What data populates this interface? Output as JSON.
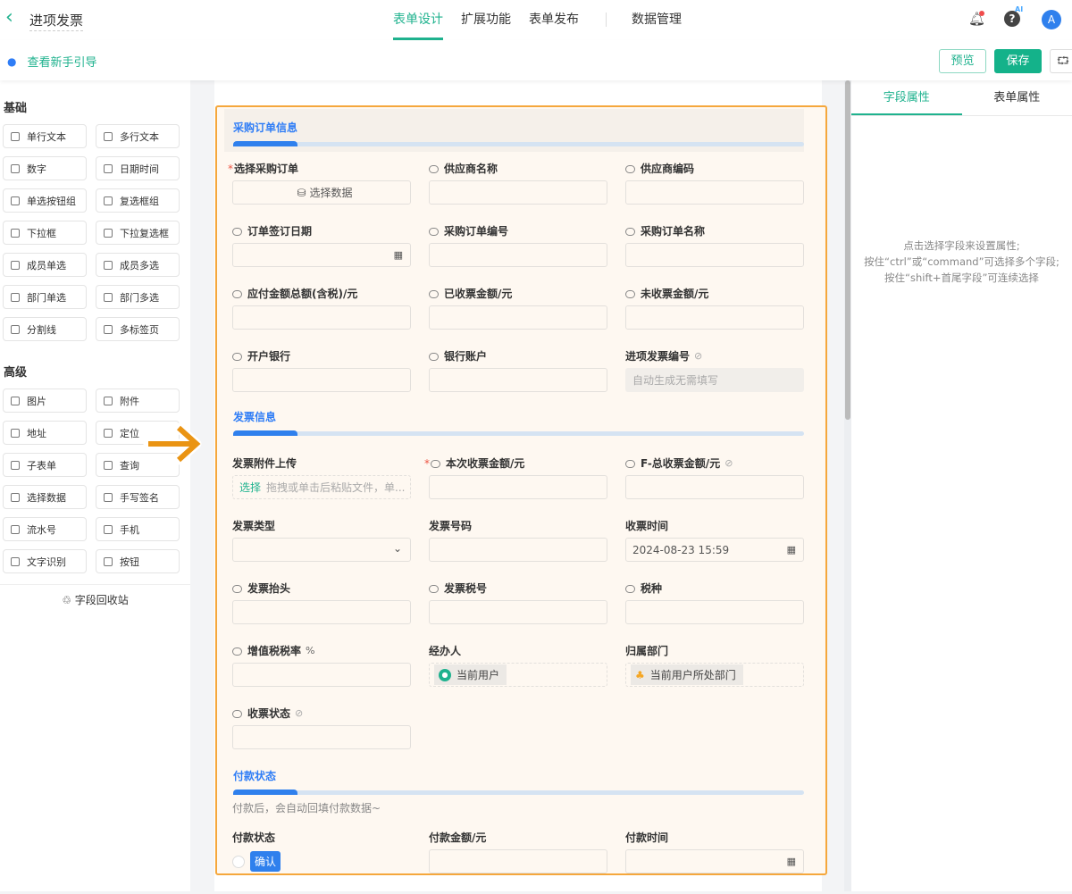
{
  "header": {
    "back_icon": "chevron-left-icon",
    "title": "进项发票",
    "tabs": [
      "表单设计",
      "扩展功能",
      "表单发布",
      "数据管理"
    ],
    "active_tab": 0,
    "ai_badge": "AI",
    "avatar": "A"
  },
  "toolbar": {
    "guide": "查看新手引导",
    "preview": "预览",
    "save": "保存"
  },
  "left": {
    "basic_title": "基础",
    "basic": [
      "单行文本",
      "多行文本",
      "数字",
      "日期时间",
      "单选按钮组",
      "复选框组",
      "下拉框",
      "下拉复选框",
      "成员单选",
      "成员多选",
      "部门单选",
      "部门多选",
      "分割线",
      "多标签页"
    ],
    "advanced_title": "高级",
    "advanced": [
      "图片",
      "附件",
      "地址",
      "定位",
      "子表单",
      "查询",
      "选择数据",
      "手写签名",
      "流水号",
      "手机",
      "文字识别",
      "按钮"
    ],
    "recycle": "字段回收站"
  },
  "sections": [
    {
      "title": "采购订单信息",
      "fields": [
        {
          "label": "选择采购订单",
          "required": true,
          "value": "选择数据"
        },
        {
          "label": "供应商名称",
          "link": true
        },
        {
          "label": "供应商编码",
          "link": true
        },
        {
          "label": "订单签订日期",
          "link": true,
          "calendar": true
        },
        {
          "label": "采购订单编号",
          "link": true
        },
        {
          "label": "采购订单名称",
          "link": true
        },
        {
          "label": "应付金额总额(含税)/元",
          "link": true
        },
        {
          "label": "已收票金额/元",
          "link": true
        },
        {
          "label": "未收票金额/元",
          "link": true
        },
        {
          "label": "开户银行",
          "link": true
        },
        {
          "label": "银行账户",
          "link": true
        },
        {
          "label": "进项发票编号",
          "hidden": true,
          "placeholder": "自动生成无需填写"
        }
      ]
    },
    {
      "title": "发票信息",
      "fields": [
        {
          "label": "发票附件上传",
          "upload_action": "选择",
          "placeholder": "拖拽或单击后粘贴文件，单..."
        },
        {
          "label": "本次收票金额/元",
          "required": true,
          "link": true
        },
        {
          "label": "F-总收票金额/元",
          "link": true,
          "hidden": true
        },
        {
          "label": "发票类型",
          "dropdown": true
        },
        {
          "label": "发票号码"
        },
        {
          "label": "收票时间",
          "value": "2024-08-23 15:59",
          "calendar": true
        },
        {
          "label": "发票抬头",
          "link": true
        },
        {
          "label": "发票税号",
          "link": true
        },
        {
          "label": "税种",
          "link": true
        },
        {
          "label": "增值税税率",
          "suffix": "%",
          "link": true
        },
        {
          "label": "经办人",
          "value": "当前用户"
        },
        {
          "label": "归属部门",
          "value": "当前用户所处部门"
        },
        {
          "label": "收票状态",
          "link": true,
          "hidden": true
        }
      ]
    },
    {
      "title": "付款状态",
      "note": "付款后，会自动回填付款数据~",
      "fields": [
        {
          "label": "付款状态",
          "button": "确认"
        },
        {
          "label": "付款金额/元"
        },
        {
          "label": "付款时间",
          "calendar": true
        }
      ]
    }
  ],
  "right": {
    "tabs": [
      "字段属性",
      "表单属性"
    ],
    "hint": [
      "点击选择字段来设置属性;",
      "按住“ctrl”或“command”可选择多个字段;",
      "按住“shift+首尾字段”可连续选择"
    ]
  },
  "colors": {
    "primary": "#1fb28e",
    "section": "#2f80ed",
    "highlight": "#f5a73c"
  }
}
